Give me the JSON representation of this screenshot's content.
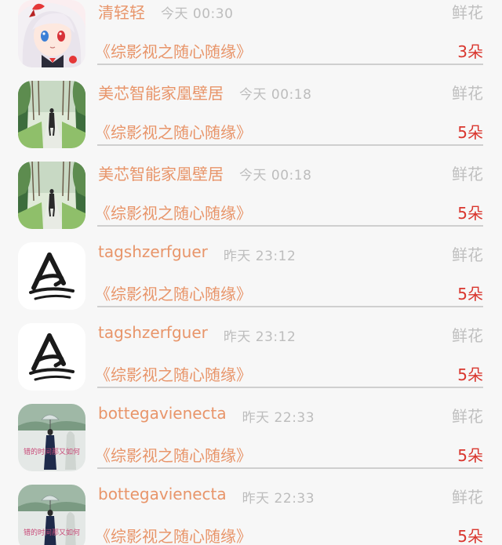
{
  "items": [
    {
      "name": "清轻轻",
      "time": "今天 00:30",
      "gift": "鲜花",
      "title": "《综影视之随心随缘》",
      "count": "3朵",
      "avatar": "anime-avatar-icon"
    },
    {
      "name": "美芯智能家凰壁居",
      "time": "今天 00:18",
      "gift": "鲜花",
      "title": "《综影视之随心随缘》",
      "count": "5朵",
      "avatar": "forest-path-avatar-icon"
    },
    {
      "name": "美芯智能家凰壁居",
      "time": "今天 00:18",
      "gift": "鲜花",
      "title": "《综影视之随心随缘》",
      "count": "5朵",
      "avatar": "forest-path-avatar-icon"
    },
    {
      "name": "tagshzerfguer",
      "time": "昨天 23:12",
      "gift": "鲜花",
      "title": "《综影视之随心随缘》",
      "count": "5朵",
      "avatar": "brush-logo-avatar-icon"
    },
    {
      "name": "tagshzerfguer",
      "time": "昨天 23:12",
      "gift": "鲜花",
      "title": "《综影视之随心随缘》",
      "count": "5朵",
      "avatar": "brush-logo-avatar-icon"
    },
    {
      "name": "bottegavienecta",
      "time": "昨天 22:33",
      "gift": "鲜花",
      "title": "《综影视之随心随缘》",
      "count": "5朵",
      "avatar": "umbrella-girl-avatar-icon",
      "avatar_caption": "错的时间那又如何"
    },
    {
      "name": "bottegavienecta",
      "time": "昨天 22:33",
      "gift": "鲜花",
      "title": "《综影视之随心随缘》",
      "count": "5朵",
      "avatar": "umbrella-girl-avatar-icon",
      "avatar_caption": "错的时间那又如何"
    }
  ],
  "colors": {
    "name": "#e8956a",
    "time": "#bdbdbd",
    "gift": "#bfbfbf",
    "count": "#d9362e",
    "divider": "#cfcfcf",
    "background": "#f7f7f7"
  }
}
